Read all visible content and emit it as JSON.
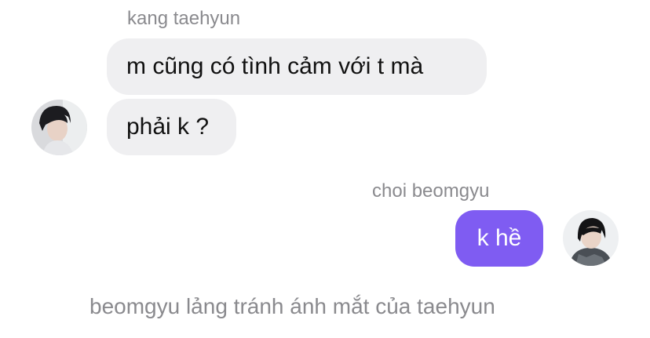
{
  "colors": {
    "incoming_bubble": "#efeff1",
    "outgoing_bubble": "#7f5cf2",
    "name_text": "#8a8a8e",
    "message_text": "#111111"
  },
  "thread": {
    "incoming": {
      "sender_name": "kang taehyun",
      "avatar_icon": "profile-photo-taehyun",
      "messages": [
        "m cũng có tình cảm với t mà",
        "phải k ?"
      ]
    },
    "outgoing": {
      "sender_name": "choi beomgyu",
      "avatar_icon": "profile-photo-beomgyu",
      "messages": [
        "k hề"
      ]
    },
    "narration": "beomgyu lảng tránh ánh mắt của taehyun"
  }
}
